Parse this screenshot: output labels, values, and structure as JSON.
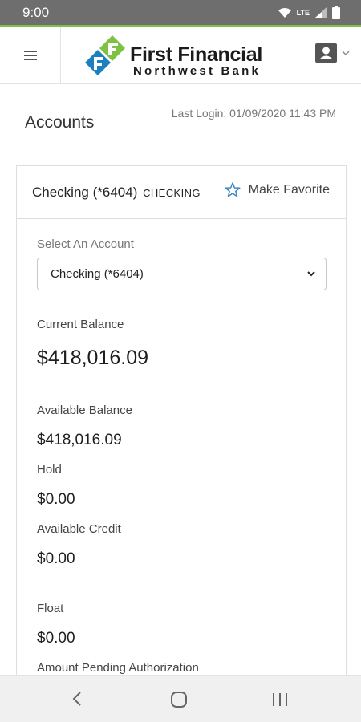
{
  "status_bar": {
    "time": "9:00",
    "network": "LTE"
  },
  "brand": {
    "line1": "First Financial",
    "line2": "Northwest Bank",
    "colors": {
      "green": "#7dc242",
      "blue": "#1c7fc0",
      "dark": "#1b1b1b"
    }
  },
  "page": {
    "title": "Accounts",
    "last_login": "Last Login: 01/09/2020 11:43 PM"
  },
  "account": {
    "name": "Checking (*6404)",
    "type": "CHECKING",
    "favorite_label": "Make Favorite",
    "select_label": "Select An Account",
    "select_value": "Checking (*6404)",
    "current_balance_label": "Current Balance",
    "current_balance": "$418,016.09",
    "available_balance_label": "Available Balance",
    "available_balance": "$418,016.09",
    "hold_label": "Hold",
    "hold": "$0.00",
    "available_credit_label": "Available Credit",
    "available_credit": "$0.00",
    "float_label": "Float",
    "float": "$0.00",
    "pending_label": "Amount Pending Authorization"
  },
  "icons": {
    "menu": "hamburger-menu-icon",
    "user": "user-profile-icon",
    "star": "star-outline-icon",
    "back": "back-chevron-icon",
    "home": "home-square-icon",
    "recents": "recents-bars-icon"
  }
}
